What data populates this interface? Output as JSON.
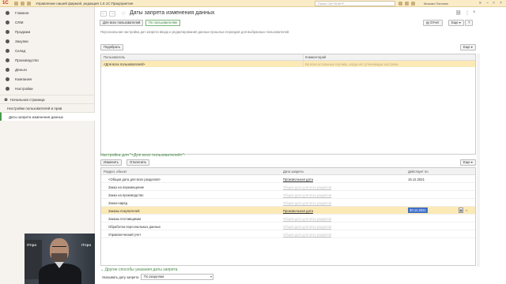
{
  "topbar": {
    "logo": "1С",
    "title": "Управление нашей фирмой, редакция 1.6 1С:Предприятие",
    "search_placeholder": "Поиск Ctrl+Shift+F",
    "user": "Михаил Панченк"
  },
  "sidebar": {
    "items": [
      {
        "label": "Главное"
      },
      {
        "label": "CRM"
      },
      {
        "label": "Продажи"
      },
      {
        "label": "Закупки"
      },
      {
        "label": "Склад"
      },
      {
        "label": "Производство"
      },
      {
        "label": "Деньги"
      },
      {
        "label": "Компания"
      },
      {
        "label": "Настройки"
      }
    ],
    "pages": [
      {
        "label": "Начальная страница"
      },
      {
        "label": "Настройки пользователей и прав"
      },
      {
        "label": "Даты запрета изменения данных"
      }
    ]
  },
  "webcam": {
    "logo1": "ITпро",
    "logo2": "ITпро"
  },
  "page": {
    "title": "Даты запрета изменения данных",
    "toggle_all": "Для всех пользователей",
    "toggle_users": "По пользователям",
    "report_btn": "Отчет",
    "more_btn": "Еще",
    "description": "Персональная настройка дат запрета ввода и редактирования данных прошлых периодов для выбранных пользователей.",
    "pick_btn": "Подобрать",
    "grid1": {
      "col_user": "Пользователь",
      "col_comment": "Комментарий",
      "row_user": "<Для всех пользователей>",
      "row_comment": "Во всех остальных случаях, когда нет уточняющих настроек."
    },
    "section_title": "Настройка для \"<Для всех пользователей>\":",
    "change_btn": "Изменить",
    "off_btn": "Отключить",
    "grid2": {
      "col_section": "Раздел, объект",
      "col_date": "Дата запрета",
      "col_active": "Действует по",
      "rows": [
        {
          "section": "<Общая дата для всех разделов>",
          "date": "Произвольная дата",
          "active": "15.12.2021"
        },
        {
          "section": "Заказ на перемещение",
          "date": "Общая дата для всех разделов",
          "active": ""
        },
        {
          "section": "Заказ на производство",
          "date": "Общая дата для всех разделов",
          "active": ""
        },
        {
          "section": "Заказ-наряд",
          "date": "Общая дата для всех разделов",
          "active": ""
        },
        {
          "section": "Заказы покупателей",
          "date": "Произвольная дата",
          "active": "30.11.2021"
        },
        {
          "section": "Заказы поставщикам",
          "date": "Общая дата для всех разделов",
          "active": ""
        },
        {
          "section": "Обработка персональных данных",
          "date": "Общая дата для всех разделов",
          "active": ""
        },
        {
          "section": "Управленческий учет",
          "date": "Общая дата для всех разделов",
          "active": ""
        }
      ]
    },
    "other_ways": "Другие способы указания даты запрета",
    "condition_label": "Указывать дату запрета",
    "condition_value": "По разделам"
  }
}
